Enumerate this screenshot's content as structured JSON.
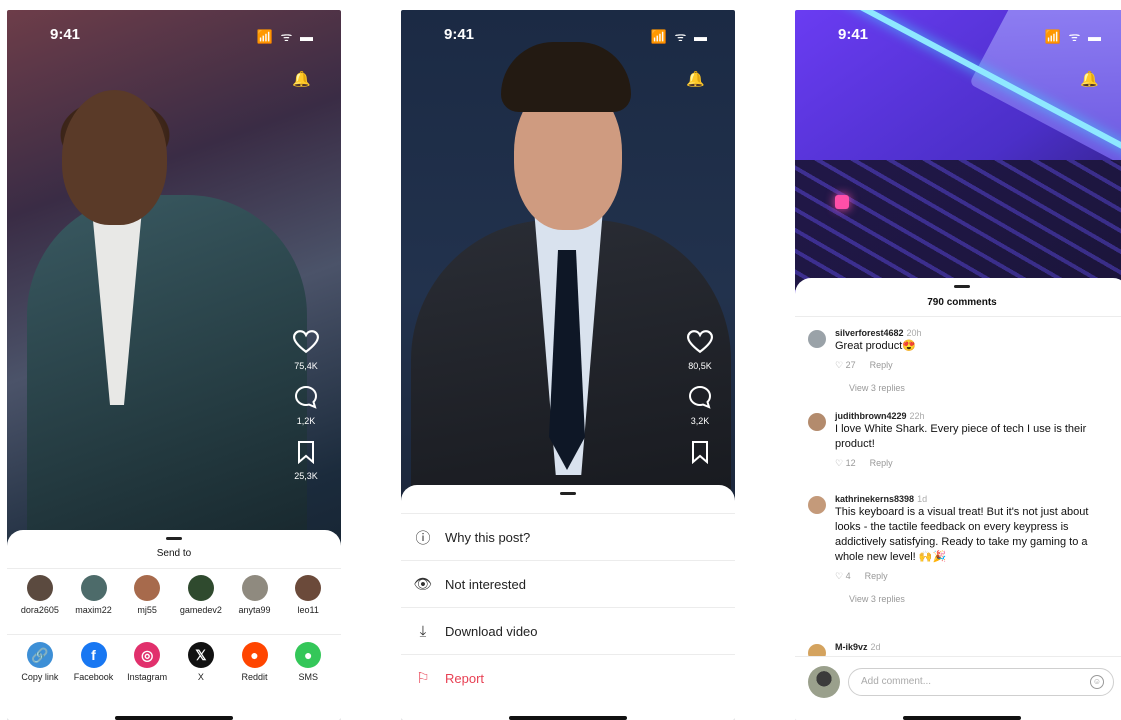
{
  "status_bar": {
    "time": "9:41",
    "icons": "📶 ᯤ ▬"
  },
  "screens": {
    "share": {
      "likes": "75,4K",
      "comments": "1,2K",
      "saves": "25,3K",
      "sheet_title": "Send to",
      "contacts": [
        {
          "name": "dora2605",
          "color": "#5b4a3f"
        },
        {
          "name": "maxim22",
          "color": "#4d6b6a"
        },
        {
          "name": "mj55",
          "color": "#a76a4c"
        },
        {
          "name": "gamedev2",
          "color": "#2f4a2e"
        },
        {
          "name": "anyta99",
          "color": "#8f8a7f"
        },
        {
          "name": "leo11",
          "color": "#6b4a3a"
        }
      ],
      "apps": [
        {
          "name": "Copy link",
          "icon": "link-icon",
          "glyph": "🔗",
          "color": "#3d8fd6"
        },
        {
          "name": "Facebook",
          "icon": "facebook-icon",
          "glyph": "f",
          "color": "#1877f2"
        },
        {
          "name": "Instagram",
          "icon": "instagram-icon",
          "glyph": "◎",
          "color": "#e1306c"
        },
        {
          "name": "X",
          "icon": "x-icon",
          "glyph": "𝕏",
          "color": "#111111"
        },
        {
          "name": "Reddit",
          "icon": "reddit-icon",
          "glyph": "●",
          "color": "#ff4500"
        },
        {
          "name": "SMS",
          "icon": "sms-icon",
          "glyph": "●",
          "color": "#34c759"
        }
      ]
    },
    "options": {
      "likes": "80,5K",
      "comments": "3,2K",
      "items": [
        {
          "label": "Why this post?",
          "icon": "info-icon",
          "glyph": "ⓘ"
        },
        {
          "label": "Not interested",
          "icon": "eye-off-icon",
          "glyph": "👁"
        },
        {
          "label": "Download video",
          "icon": "download-icon",
          "glyph": "⤓"
        },
        {
          "label": "Report",
          "icon": "flag-icon",
          "glyph": "⚐"
        }
      ]
    },
    "comments": {
      "title": "790 comments",
      "items": [
        {
          "user": "silverforest4682",
          "time": "20h",
          "text": "Great product😍",
          "likes": "27",
          "reply": "Reply",
          "replies": "View 3 replies",
          "color": "#9aa2a8"
        },
        {
          "user": "judithbrown4229",
          "time": "22h",
          "text": "I love White Shark. Every piece of tech I use is their product!",
          "likes": "12",
          "reply": "Reply",
          "replies": "",
          "color": "#b38b6d"
        },
        {
          "user": "kathrinekerns8398",
          "time": "1d",
          "text": "This keyboard is a visual treat! But it's not just about looks - the tactile feedback on every keypress is addictively satisfying. Ready to take my gaming to a whole new level! 🙌🎉",
          "likes": "4",
          "reply": "Reply",
          "replies": "View 3 replies",
          "color": "#c49a7a"
        },
        {
          "user": "M-ik9vz",
          "time": "2d",
          "text": "",
          "likes": "",
          "reply": "",
          "replies": "",
          "color": "#d4a35f"
        }
      ],
      "composer_placeholder": "Add comment..."
    }
  }
}
